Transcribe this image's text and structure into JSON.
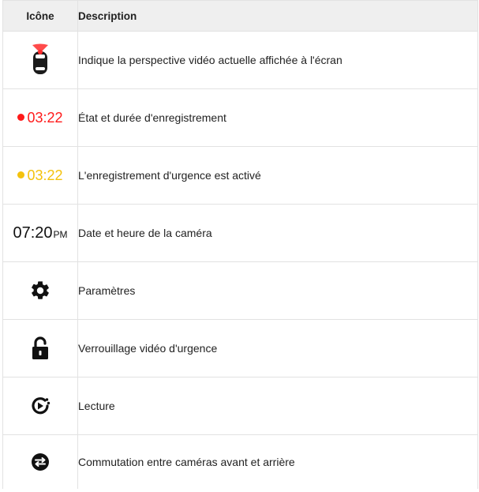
{
  "table": {
    "header_icon": "Icône",
    "header_description": "Description"
  },
  "rows": [
    {
      "icon": "car-top-view-icon",
      "description": "Indique la perspective vidéo actuelle affichée à l'écran"
    },
    {
      "icon": "red-dot-icon",
      "status_time": "03:22",
      "status_color": "#ff1a1a",
      "description": "État et durée d'enregistrement"
    },
    {
      "icon": "yellow-dot-icon",
      "status_time": "03:22",
      "status_color": "#f4c20d",
      "description": "L'enregistrement d'urgence est activé"
    },
    {
      "clock_time": "07:20",
      "clock_ampm": "PM",
      "description": "Date et heure de la caméra"
    },
    {
      "icon": "gear-icon",
      "description": "Paramètres"
    },
    {
      "icon": "lock-open-icon",
      "description": "Verrouillage vidéo d'urgence"
    },
    {
      "icon": "playback-icon",
      "description": "Lecture"
    },
    {
      "icon": "swap-arrows-icon",
      "description": "Commutation entre caméras avant et arrière"
    }
  ]
}
